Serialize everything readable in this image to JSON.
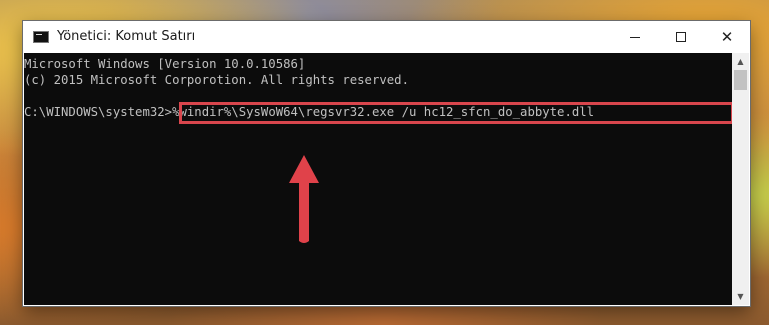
{
  "window": {
    "title": "Yönetici: Komut Satırı",
    "minimize_glyph": "",
    "maximize_glyph": "",
    "close_glyph": "✕"
  },
  "console": {
    "lines": [
      "Microsoft Windows [Version 10.0.10586]",
      "(c) 2015 Microsoft Corporotion. All rights reserved."
    ],
    "prompt": "C:\\WINDOWS\\system32>",
    "command": "%windir%\\SysWoW64\\regsvr32.exe /u hc12_sfcn_do_abbyte.dll"
  },
  "annotation": {
    "highlight_color": "#d9464d",
    "arrow_color": "#e0424a"
  },
  "scrollbar": {
    "up_glyph": "▲",
    "down_glyph": "▼"
  },
  "icons": [
    "console-app-icon",
    "minimize-icon",
    "maximize-icon",
    "close-icon",
    "red-arrow-icon"
  ]
}
